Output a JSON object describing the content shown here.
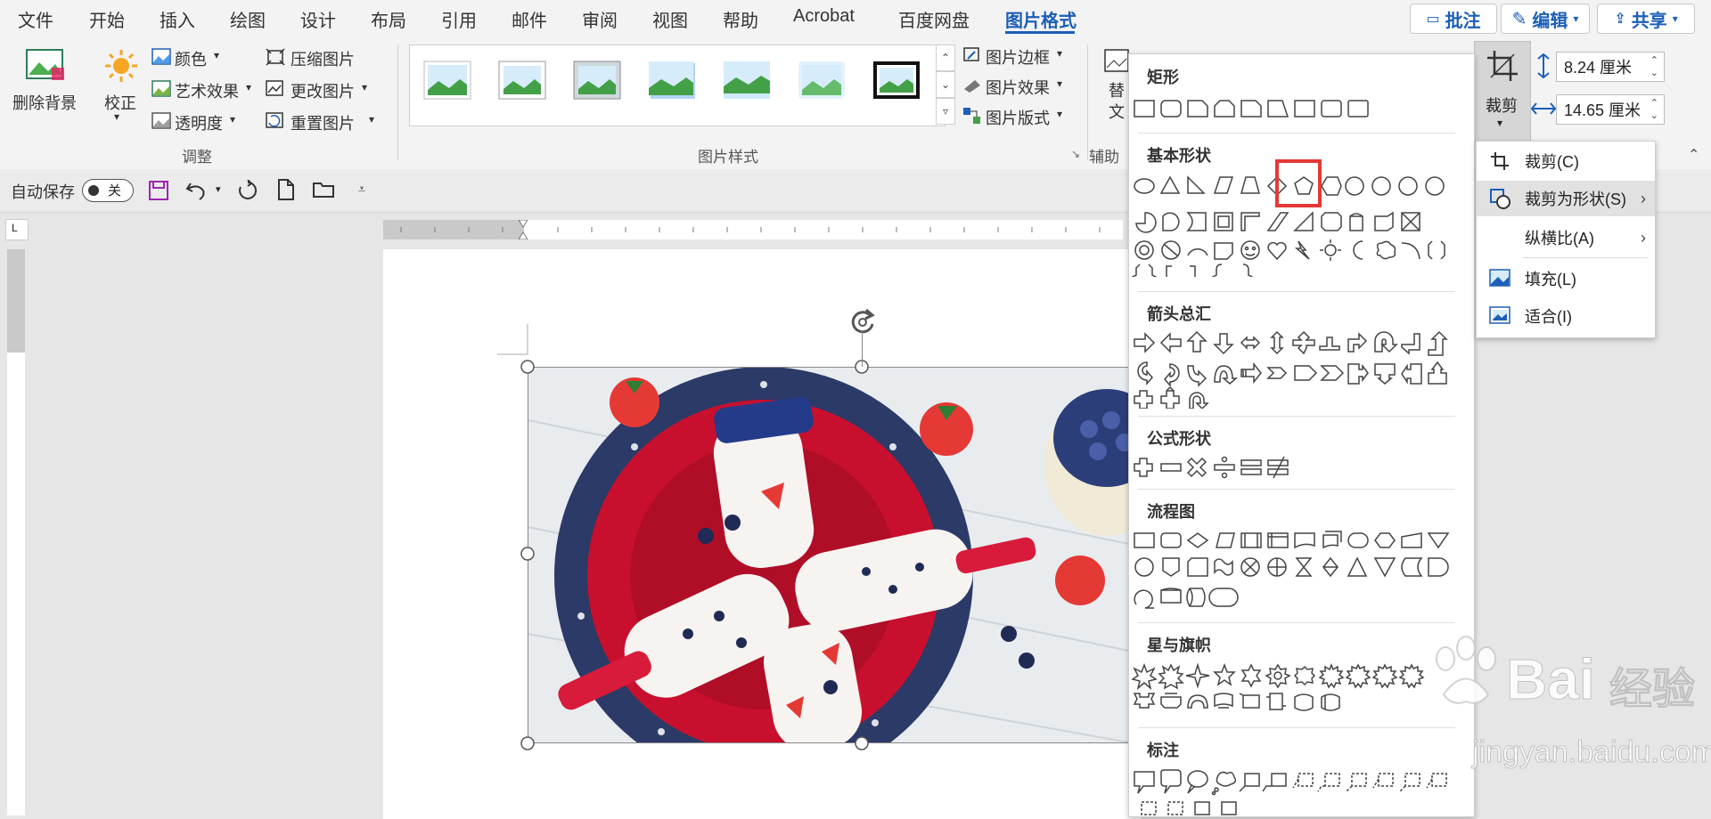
{
  "menu": {
    "items": [
      "文件",
      "开始",
      "插入",
      "绘图",
      "设计",
      "布局",
      "引用",
      "邮件",
      "审阅",
      "视图",
      "帮助",
      "Acrobat",
      "百度网盘",
      "图片格式"
    ],
    "active": "图片格式",
    "comment_btn": "批注",
    "edit_btn": "编辑",
    "share_btn": "共享"
  },
  "ribbon": {
    "remove_bg": "删除背景",
    "corrections": "校正",
    "color": "颜色",
    "artistic": "艺术效果",
    "transparency": "透明度",
    "compress": "压缩图片",
    "change": "更改图片",
    "reset": "重置图片",
    "adjust_group": "调整",
    "picture_styles_group": "图片样式",
    "border": "图片边框",
    "effects": "图片效果",
    "layout": "图片版式",
    "alt_text_1": "替",
    "alt_text_2": "文",
    "aux_group": "辅助",
    "crop": "裁剪",
    "height": "8.24 厘米",
    "width": "14.65 厘米"
  },
  "qat": {
    "autosave": "自动保存",
    "toggle": "关"
  },
  "shape_panel": {
    "sections": [
      "矩形",
      "基本形状",
      "箭头总汇",
      "公式形状",
      "流程图",
      "星与旗帜",
      "标注"
    ]
  },
  "crop_menu": {
    "items": [
      {
        "label": "裁剪(C)",
        "submenu": false
      },
      {
        "label": "裁剪为形状(S)",
        "submenu": true
      },
      {
        "label": "纵横比(A)",
        "submenu": true
      },
      {
        "label": "填充(L)",
        "submenu": false
      },
      {
        "label": "适合(I)",
        "submenu": false
      }
    ]
  },
  "watermark": {
    "brand": "Bai",
    "brand_cn": "经验",
    "url": "jingyan.baidu.com"
  },
  "colors": {
    "accent": "#1c5fb7",
    "highlight_box": "#e53935"
  }
}
